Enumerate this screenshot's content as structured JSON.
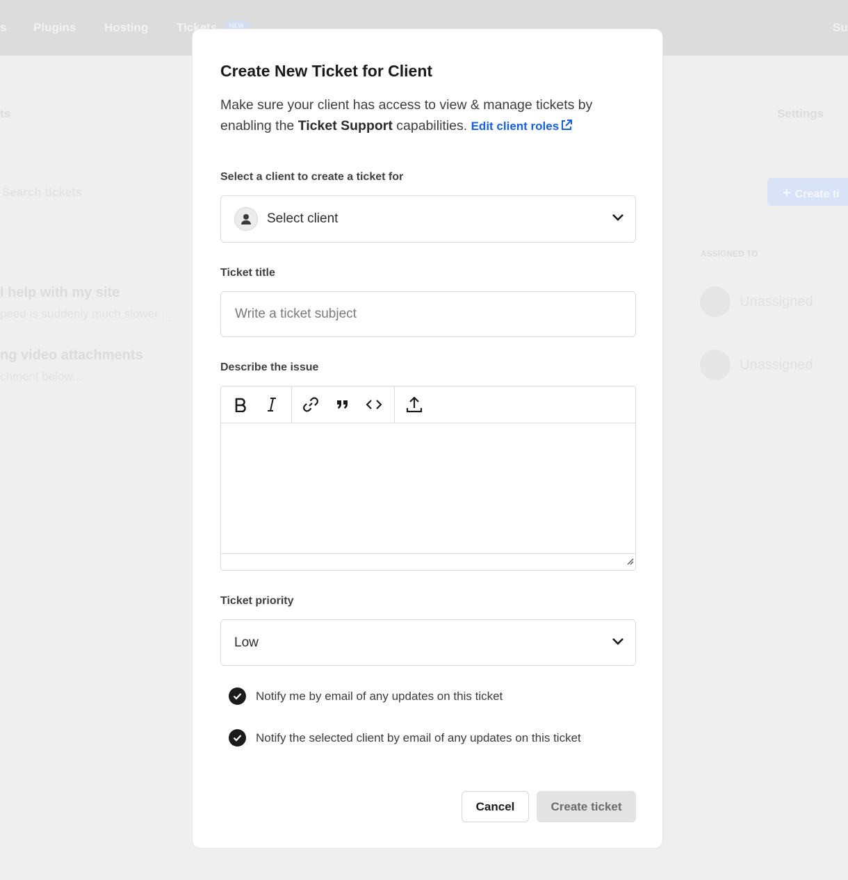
{
  "background": {
    "nav": {
      "items": [
        "s",
        "Plugins",
        "Hosting",
        "Tickets"
      ],
      "badge": "NEW",
      "right": "Su"
    },
    "page_title_fragment": "ts",
    "settings": "Settings",
    "search_placeholder": "Search tickets",
    "create_button": "Create ti",
    "assigned_header": "ASSIGNED TO",
    "tickets": [
      {
        "title": "l help with my site",
        "excerpt": "peed is suddenly much slower ...",
        "assignee": "Unassigned"
      },
      {
        "title": "ng video attachments",
        "excerpt": "chment below...",
        "assignee": "Unassigned"
      }
    ]
  },
  "modal": {
    "title": "Create New Ticket for Client",
    "description_part1": "Make sure your client has access to view & manage tickets by enabling the ",
    "description_bold": "Ticket Support",
    "description_part2": " capabilities.",
    "edit_roles_link": "Edit client roles",
    "client_label": "Select a client to create a ticket for",
    "client_select_value": "Select client",
    "title_label": "Ticket title",
    "title_placeholder": "Write a ticket subject",
    "describe_label": "Describe the issue",
    "toolbar": [
      "bold-icon",
      "italic-icon",
      "link-icon",
      "quote-icon",
      "code-icon",
      "upload-icon"
    ],
    "priority_label": "Ticket priority",
    "priority_value": "Low",
    "notify_me": "Notify me by email of any updates on this ticket",
    "notify_client": "Notify the selected client by email of any updates on this ticket",
    "notify_me_checked": true,
    "notify_client_checked": true,
    "cancel_label": "Cancel",
    "create_label": "Create ticket"
  },
  "colors": {
    "link": "#1660e6",
    "checkbox": "#1b1b1b",
    "disabled_button": "#e3e3e3"
  }
}
